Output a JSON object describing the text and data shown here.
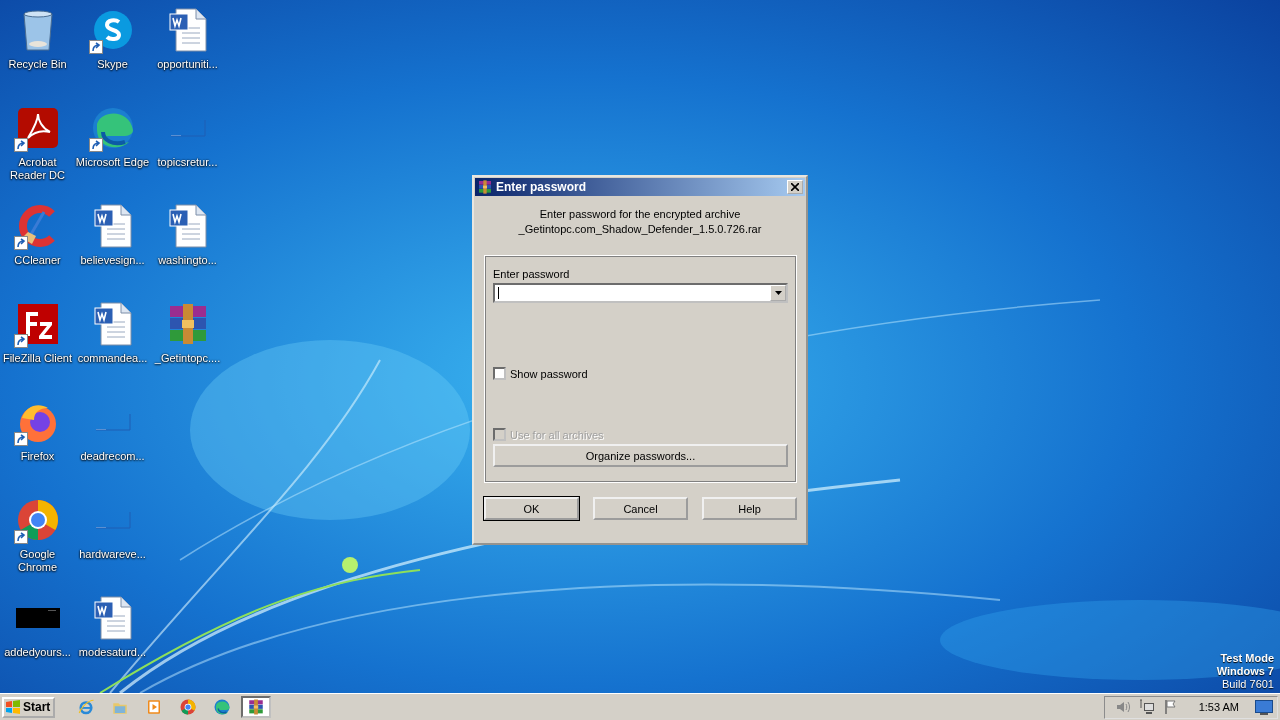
{
  "desktop": {
    "icons": [
      {
        "label": "Recycle Bin",
        "kind": "recycle",
        "shortcut": false
      },
      {
        "label": "Acrobat Reader DC",
        "kind": "acrobat",
        "shortcut": true
      },
      {
        "label": "CCleaner",
        "kind": "ccleaner",
        "shortcut": true
      },
      {
        "label": "FileZilla Client",
        "kind": "filezilla",
        "shortcut": true
      },
      {
        "label": "Firefox",
        "kind": "firefox",
        "shortcut": true
      },
      {
        "label": "Google Chrome",
        "kind": "chrome",
        "shortcut": true
      },
      {
        "label": "addedyours...",
        "kind": "black",
        "shortcut": false
      },
      {
        "label": "Skype",
        "kind": "skype",
        "shortcut": true
      },
      {
        "label": "Microsoft Edge",
        "kind": "edge",
        "shortcut": true
      },
      {
        "label": "believesign...",
        "kind": "word",
        "shortcut": false
      },
      {
        "label": "commandea...",
        "kind": "word",
        "shortcut": false
      },
      {
        "label": "deadrecom...",
        "kind": "blank",
        "shortcut": false
      },
      {
        "label": "hardwareve...",
        "kind": "blank",
        "shortcut": false
      },
      {
        "label": "modesaturd...",
        "kind": "word",
        "shortcut": false
      },
      {
        "label": "opportuniti...",
        "kind": "word",
        "shortcut": false
      },
      {
        "label": "topicsretur...",
        "kind": "blank",
        "shortcut": false
      },
      {
        "label": "washingto...",
        "kind": "word",
        "shortcut": false
      },
      {
        "label": "_Getintopc....",
        "kind": "winrar",
        "shortcut": false
      }
    ],
    "test_mode": [
      "Test Mode",
      "Windows 7",
      "Build 7601"
    ]
  },
  "dialog": {
    "title": "Enter password",
    "message_lines": [
      "Enter password for the encrypted archive",
      "_Getintopc.com_Shadow_Defender_1.5.0.726.rar"
    ],
    "password_label": "Enter password",
    "show_password": {
      "label": "Show password",
      "checked": false,
      "disabled": false
    },
    "use_for_all": {
      "label": "Use for all archives",
      "checked": false,
      "disabled": true
    },
    "organize_button": "Organize passwords...",
    "buttons": [
      {
        "label": "OK",
        "default": true
      },
      {
        "label": "Cancel",
        "default": false
      },
      {
        "label": "Help",
        "default": false
      }
    ]
  },
  "taskbar": {
    "start_label": "Start",
    "items": [
      {
        "kind": "ie",
        "selected": false
      },
      {
        "kind": "folder",
        "selected": false
      },
      {
        "kind": "media",
        "selected": false
      },
      {
        "kind": "chrome",
        "selected": false
      },
      {
        "kind": "edge",
        "selected": false
      },
      {
        "kind": "winrar",
        "selected": true
      }
    ],
    "clock": "1:53 AM"
  }
}
